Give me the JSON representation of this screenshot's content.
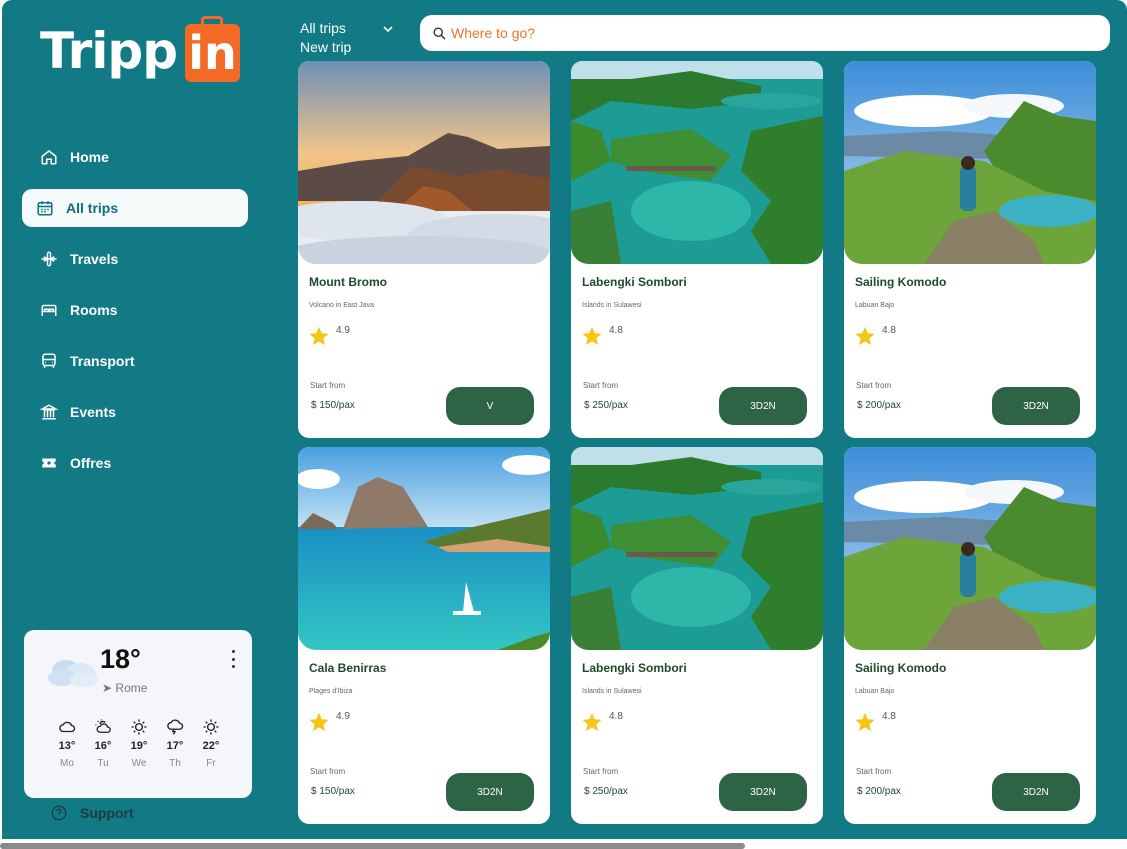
{
  "brand": {
    "name_part1": "Tripp",
    "name_part2": "in",
    "accent_color": "#f26a25"
  },
  "sidebar": {
    "items": [
      {
        "label": "Home",
        "icon": "home-icon",
        "active": false
      },
      {
        "label": "All trips",
        "icon": "calendar-icon",
        "active": true
      },
      {
        "label": "Travels",
        "icon": "plane-icon",
        "active": false
      },
      {
        "label": "Rooms",
        "icon": "bed-icon",
        "active": false
      },
      {
        "label": "Transport",
        "icon": "car-icon",
        "active": false
      },
      {
        "label": "Events",
        "icon": "building-icon",
        "active": false
      },
      {
        "label": "Offres",
        "icon": "ticket-icon",
        "active": false
      }
    ],
    "support_label": "Support"
  },
  "weather": {
    "temperature": "18°",
    "location": "Rome",
    "forecast": [
      {
        "temp": "13°",
        "day": "Mo",
        "icon": "cloud-icon"
      },
      {
        "temp": "16°",
        "day": "Tu",
        "icon": "partly-cloudy-icon"
      },
      {
        "temp": "19°",
        "day": "We",
        "icon": "sun-icon"
      },
      {
        "temp": "17°",
        "day": "Th",
        "icon": "cloud-rain-icon"
      },
      {
        "temp": "22°",
        "day": "Fr",
        "icon": "sun-icon"
      }
    ]
  },
  "topbar": {
    "trip_filter_selected": "All trips",
    "trip_filter_option": "New trip",
    "search_placeholder": "Where to go?"
  },
  "cards": [
    {
      "title": "Mount Bromo",
      "subtitle": "Volcano in East Java",
      "rating": "4.9",
      "from_label": "Start from",
      "price": "$ 150/pax",
      "button": "V",
      "image": "volcano"
    },
    {
      "title": "Labengki Sombori",
      "subtitle": "Islands in Sulawesi",
      "rating": "4.8",
      "from_label": "Start from",
      "price": "$ 250/pax",
      "button": "3D2N",
      "image": "lagoon"
    },
    {
      "title": "Sailing Komodo",
      "subtitle": "Labuan Bajo",
      "rating": "4.8",
      "from_label": "Start from",
      "price": "$ 200/pax",
      "button": "3D2N",
      "image": "hills"
    },
    {
      "title": "Cala Benirras",
      "subtitle": "Plages d'Ibiza",
      "rating": "4.9",
      "from_label": "Start from",
      "price": "$ 150/pax",
      "button": "3D2N",
      "image": "bay"
    },
    {
      "title": "Labengki Sombori",
      "subtitle": "Islands in Sulawesi",
      "rating": "4.8",
      "from_label": "Start from",
      "price": "$ 250/pax",
      "button": "3D2N",
      "image": "lagoon"
    },
    {
      "title": "Sailing Komodo",
      "subtitle": "Labuan Bajo",
      "rating": "4.8",
      "from_label": "Start from",
      "price": "$ 200/pax",
      "button": "3D2N",
      "image": "hills"
    }
  ],
  "colors": {
    "background": "#117a85",
    "button": "#2d6445",
    "star": "#f5c518"
  }
}
